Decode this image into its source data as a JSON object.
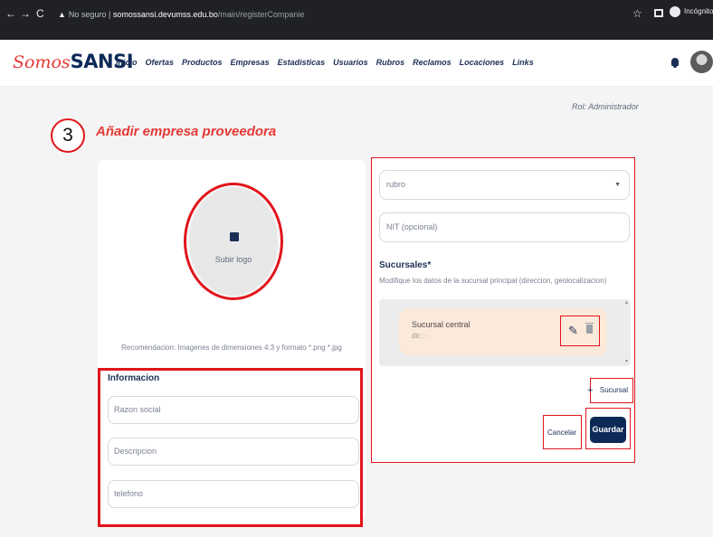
{
  "browser": {
    "back": "←",
    "forward": "→",
    "reload": "C",
    "security_warning": "▲",
    "security_label": "No seguro",
    "url_host": "somossansi.devumss.edu.bo",
    "url_path": "/main/registerCompanie",
    "profile_label": "Incógnito"
  },
  "app": {
    "logo_part1": "Somos",
    "logo_part2": "SANSI",
    "nav": [
      "Inicio",
      "Ofertas",
      "Productos",
      "Empresas",
      "Estadisticas",
      "Usuarios",
      "Rubros",
      "Reclamos",
      "Locaciones",
      "Links"
    ]
  },
  "page": {
    "role": "Rol: Administrador",
    "step_number": "3",
    "title": "Añadir empresa proveedora"
  },
  "upload": {
    "label": "Subir logo",
    "recommendation": "Recomendacion: Imagenes de dimensiones 4:3 y formato *.png *.jpg"
  },
  "info": {
    "heading": "Informacion",
    "fields": {
      "razon_social": "Razon social",
      "descripcion": "Descripcion",
      "telefono": "telefono"
    }
  },
  "company": {
    "rubro_placeholder": "rubro",
    "nit_placeholder": "NIT (opcional)",
    "sucursales_label": "Sucursales*",
    "sucursales_hint": "Modifique los datos de la sucursal principal (direccion, geolocalizacion)",
    "branch": {
      "name": "Sucursal central",
      "address": "dir.: -"
    },
    "add_branch_label": "Sucursal",
    "cancel_label": "Cancelar",
    "save_label": "Guardar"
  },
  "colors": {
    "accent_red": "#e53935",
    "brand_navy": "#0d2a57",
    "annotation_red": "#e0151b",
    "branch_bg": "#fbe9d9"
  }
}
